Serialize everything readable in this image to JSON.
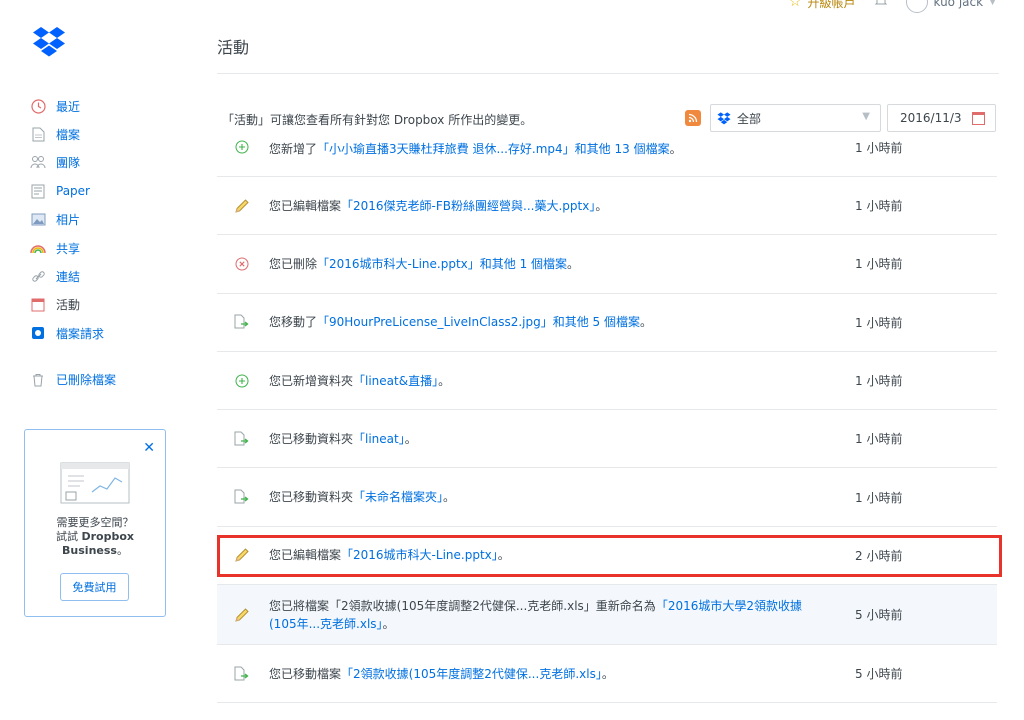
{
  "topbar": {
    "upgrade_label": "升級帳戶",
    "user_name": "kuo jack"
  },
  "sidebar": {
    "items": [
      {
        "label": "最近",
        "icon": "clock-icon"
      },
      {
        "label": "檔案",
        "icon": "file-icon"
      },
      {
        "label": "團隊",
        "icon": "team-icon"
      },
      {
        "label": "Paper",
        "icon": "paper-icon"
      },
      {
        "label": "相片",
        "icon": "photo-icon"
      },
      {
        "label": "共享",
        "icon": "rainbow-icon"
      },
      {
        "label": "連結",
        "icon": "link-icon"
      },
      {
        "label": "活動",
        "icon": "calendar-icon"
      },
      {
        "label": "檔案請求",
        "icon": "file-request-icon"
      }
    ],
    "deleted_label": "已刪除檔案"
  },
  "promo": {
    "line1": "需要更多空間？",
    "line2_prefix": "試試 ",
    "line2_bold": "Dropbox",
    "line3_bold": "Business",
    "line3_suffix": "。",
    "button": "免費試用"
  },
  "main": {
    "title": "活動",
    "description": "「活動」可讓您查看所有針對您 Dropbox 所作出的變更。",
    "filter_value": "全部",
    "date_value": "2016/11/3"
  },
  "activities": [
    {
      "icon": "add-icon",
      "pre": "您新增了",
      "link": "「小小瑜直播3天賺杜拜旅費 退休...存好.mp4」和其他 13 個檔案",
      "post": "。",
      "time": "1 小時前"
    },
    {
      "icon": "pencil-icon",
      "pre": "您已編輯檔案",
      "link": "「2016傑克老師-FB粉絲團經營與...藥大.pptx」",
      "post": "。",
      "time": "1 小時前"
    },
    {
      "icon": "delete-icon",
      "pre": "您已刪除",
      "link": "「2016城市科大-Line.pptx」和其他 1 個檔案",
      "post": "。",
      "time": "1 小時前"
    },
    {
      "icon": "move-icon",
      "pre": "您移動了",
      "link": "「90HourPreLicense_LiveInClass2.jpg」和其他 5 個檔案",
      "post": "。",
      "time": "1 小時前"
    },
    {
      "icon": "add-icon",
      "pre": "您已新增資料夾",
      "link": "「lineat&直播」",
      "post": "。",
      "time": "1 小時前"
    },
    {
      "icon": "move-icon",
      "pre": "您已移動資料夾",
      "link": "「lineat」",
      "post": "。",
      "time": "1 小時前"
    },
    {
      "icon": "move-icon",
      "pre": "您已移動資料夾",
      "link": "「未命名檔案夾」",
      "post": "。",
      "time": "1 小時前"
    },
    {
      "icon": "pencil-icon",
      "pre": "您已編輯檔案",
      "link": "「2016城市科大-Line.pptx」",
      "post": "。",
      "time": "2 小時前"
    },
    {
      "icon": "pencil-icon",
      "pre": "您已將檔案「2領款收據(105年度調整2代健保...克老師.xls」重新命名為",
      "link": "「2016城市大學2領款收據(105年...克老師.xls」",
      "post": "。",
      "time": "5 小時前"
    },
    {
      "icon": "move-icon",
      "pre": "您已移動檔案",
      "link": "「2領款收據(105年度調整2代健保...克老師.xls」",
      "post": "。",
      "time": "5 小時前"
    }
  ],
  "colors": {
    "link": "#0070e0",
    "highlight": "#e8332a",
    "add": "#3eb34a",
    "delete": "#e06b6b",
    "rss": "#f0883e"
  }
}
